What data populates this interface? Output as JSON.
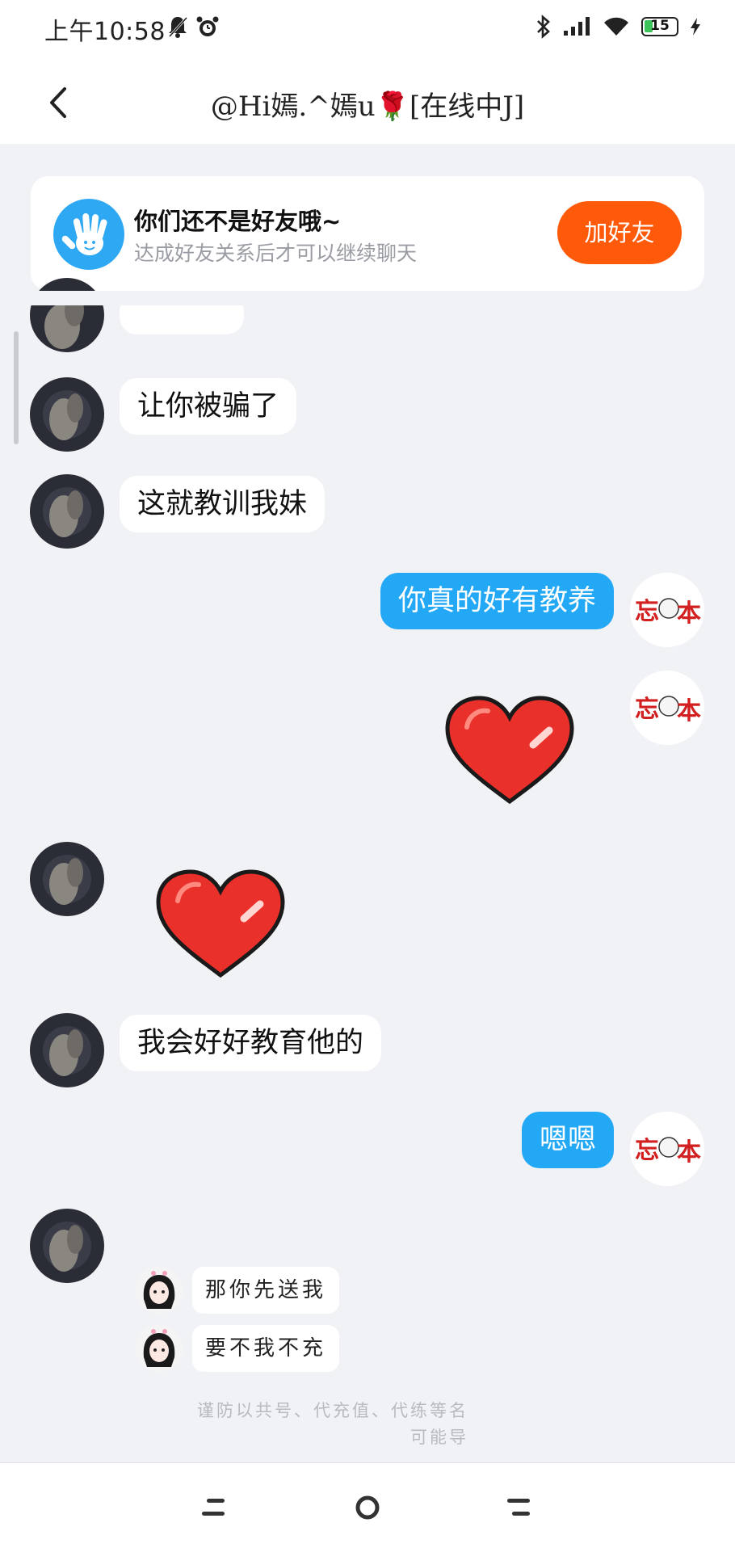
{
  "status_bar": {
    "time": "上午10:58",
    "battery_level": "15"
  },
  "header": {
    "title": "@Hi嫣.^嫣u🌹[在线中J]"
  },
  "friend_banner": {
    "title": "你们还不是好友哦~",
    "subtitle": "达成好友关系后才可以继续聊天",
    "add_button_label": "加好友"
  },
  "messages": [
    {
      "side": "left",
      "type": "text",
      "text": "让你被骗了"
    },
    {
      "side": "left",
      "type": "text",
      "text": "这就教训我妹"
    },
    {
      "side": "right",
      "type": "text",
      "text": "你真的好有教养"
    },
    {
      "side": "right",
      "type": "sticker",
      "sticker": "red-heart"
    },
    {
      "side": "left",
      "type": "sticker",
      "sticker": "red-heart"
    },
    {
      "side": "left",
      "type": "text",
      "text": "我会好好教育他的"
    },
    {
      "side": "right",
      "type": "text",
      "text": "嗯嗯"
    },
    {
      "side": "left",
      "type": "image",
      "lines": [
        "那你先送我",
        "要不我不充"
      ]
    }
  ],
  "image_notice": {
    "line1": "谨防以共号、代充值、代练等名",
    "line2": "可能导"
  },
  "colors": {
    "accent_blue": "#23a8f5",
    "add_button": "#ff5a0a",
    "background": "#f1f2f6"
  }
}
